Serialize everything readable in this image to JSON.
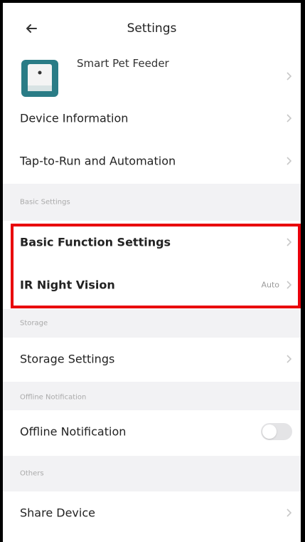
{
  "header": {
    "title": "Settings",
    "back_icon": "back-arrow-icon"
  },
  "device": {
    "name": "Smart Pet Feeder",
    "image_icon": "pet-feeder-device-icon"
  },
  "items": {
    "device_information": "Device Information",
    "tap_to_run": "Tap-to-Run and Automation",
    "basic_function_settings": "Basic Function Settings",
    "ir_night_vision": "IR Night Vision",
    "ir_night_vision_value": "Auto",
    "storage_settings": "Storage Settings",
    "offline_notification": "Offline Notification",
    "share_device": "Share Device"
  },
  "sections": {
    "basic_settings": "Basic Settings",
    "storage": "Storage",
    "offline_notification": "Offline Notification",
    "others": "Others"
  },
  "toggles": {
    "offline_notification_on": false
  },
  "colors": {
    "highlight": "#e8000b",
    "section_bg": "#f2f2f4",
    "device_accent": "#2a7c86"
  }
}
